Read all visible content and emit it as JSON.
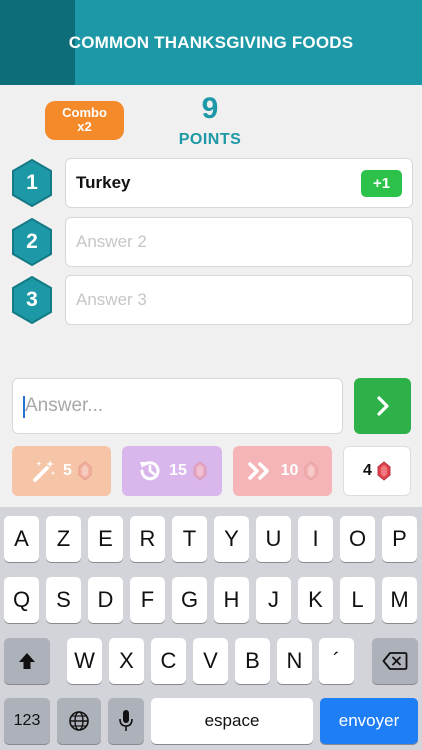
{
  "header": {
    "title": "COMMON THANKSGIVING FOODS"
  },
  "combo": {
    "line1": "Combo",
    "line2": "x2"
  },
  "score": {
    "value": "9",
    "label": "POINTS"
  },
  "answers": [
    {
      "number": "1",
      "text": "Turkey",
      "badge": "+1"
    },
    {
      "number": "2",
      "placeholder": "Answer 2"
    },
    {
      "number": "3",
      "placeholder": "Answer 3"
    }
  ],
  "input": {
    "placeholder": "Answer...",
    "value": ""
  },
  "powerups": {
    "wand": {
      "icon": "magic-wand-icon",
      "cost": "5"
    },
    "time": {
      "icon": "history-icon",
      "cost": "15"
    },
    "skip": {
      "icon": "fast-forward-icon",
      "cost": "10"
    },
    "gems": {
      "icon": "gem-icon",
      "count": "4"
    }
  },
  "keyboard": {
    "row1": [
      "A",
      "Z",
      "E",
      "R",
      "T",
      "Y",
      "U",
      "I",
      "O",
      "P"
    ],
    "row2": [
      "Q",
      "S",
      "D",
      "F",
      "G",
      "H",
      "J",
      "K",
      "L",
      "M"
    ],
    "row3": [
      "W",
      "X",
      "C",
      "V",
      "B",
      "N",
      "´"
    ],
    "numbers_label": "123",
    "space_label": "espace",
    "send_label": "envoyer"
  },
  "colors": {
    "teal": "#1d98a6",
    "teal_dark": "#0d6d79",
    "orange": "#f58a2a",
    "green": "#2cc24a",
    "blue": "#1e7ef5"
  }
}
